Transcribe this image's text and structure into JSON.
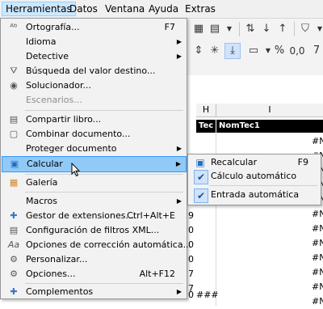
{
  "menubar": {
    "items": [
      {
        "label": "Herramientas",
        "active": true
      },
      {
        "label": "Datos"
      },
      {
        "label": "Ventana"
      },
      {
        "label": "Ayuda"
      },
      {
        "label": "Extras"
      }
    ]
  },
  "toolbar": {
    "row1": [
      "sort-asc-icon",
      "sort-desc-icon",
      "filter-icon",
      "grid-icon",
      "chevron-down-icon"
    ],
    "row2": [
      "merge-icon",
      "align-bottom-icon",
      "currency-icon",
      "percent-icon",
      "decimal-icon"
    ],
    "percent_glyph": "%",
    "decimal_glyph": "0,0",
    "last_glyph": "7"
  },
  "sheet": {
    "col_headers": [
      "H",
      "I"
    ],
    "header_cells": [
      "Tec",
      "NomTec1"
    ],
    "right_values": [
      "#N",
      "#N",
      "#N",
      "#N",
      "#N",
      "#N",
      "#N",
      "#N",
      "#N",
      "#N",
      "#N",
      "#N"
    ],
    "left_digits": [
      "9",
      "0",
      "0",
      "0",
      "7",
      "7",
      "0"
    ],
    "bottom_hash": "###"
  },
  "menu": {
    "items": [
      {
        "label": "Ortografía...",
        "shortcut": "F7",
        "icon": "spellcheck-icon"
      },
      {
        "label": "Idioma",
        "submenu": true
      },
      {
        "label": "Detective",
        "submenu": true
      },
      {
        "label": "Búsqueda del valor destino...",
        "icon": "goal-seek-icon"
      },
      {
        "label": "Solucionador...",
        "icon": "solver-icon"
      },
      {
        "label": "Escenarios...",
        "disabled": true
      },
      {
        "label": "Compartir libro...",
        "icon": "share-icon"
      },
      {
        "label": "Combinar documento...",
        "icon": "merge-doc-icon"
      },
      {
        "label": "Proteger documento",
        "submenu": true
      },
      {
        "label": "Calcular",
        "submenu": true,
        "icon": "calculate-icon",
        "highlighted": true
      },
      {
        "label": "Galería",
        "icon": "gallery-icon"
      },
      {
        "label": "Macros",
        "submenu": true
      },
      {
        "label": "Gestor de extensiones...",
        "shortcut": "Ctrl+Alt+E",
        "icon": "extension-icon"
      },
      {
        "label": "Configuración de filtros XML...",
        "icon": "xml-filter-icon"
      },
      {
        "label": "Opciones de corrección automática...",
        "icon": "autocorrect-icon"
      },
      {
        "label": "Personalizar...",
        "icon": "customize-icon"
      },
      {
        "label": "Opciones...",
        "shortcut": "Alt+F12",
        "icon": "options-icon"
      },
      {
        "label": "Complementos",
        "submenu": true,
        "icon": "addons-icon"
      }
    ]
  },
  "submenu": {
    "items": [
      {
        "label": "Recalcular",
        "shortcut": "F9",
        "icon": "recalc-icon"
      },
      {
        "label": "Cálculo automático",
        "checked": true
      },
      {
        "label": "Entrada automática",
        "checked": true
      }
    ]
  },
  "colors": {
    "highlight": "#91c9f7",
    "menubar_active": "#cce8ff",
    "check_accent": "#1f4e9b"
  }
}
